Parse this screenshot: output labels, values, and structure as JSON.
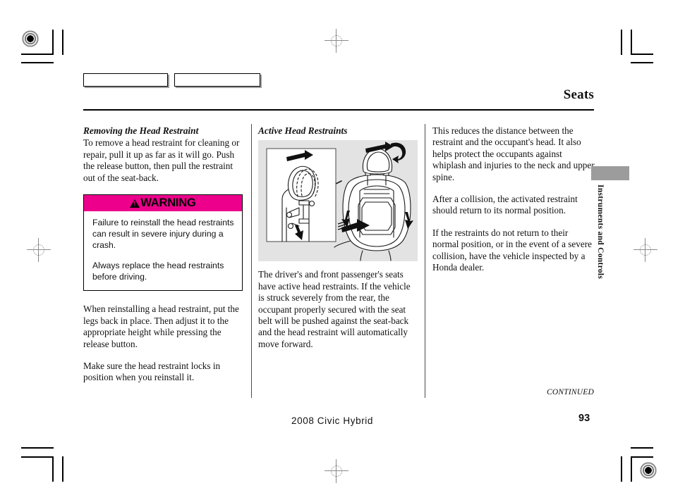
{
  "document": {
    "section_title": "Seats",
    "footer_model": "2008  Civic  Hybrid",
    "page_number": "93",
    "continued_label": "CONTINUED",
    "side_tab_label": "Instruments and Controls"
  },
  "colors": {
    "warning_header_bg": "#ec008c",
    "side_tab_bg": "#9c9c9c",
    "figure_bg": "#e3e3e3",
    "text": "#111111"
  },
  "column1": {
    "heading": "Removing the Head Restraint",
    "paragraphs": [
      "To remove a head restraint for cleaning or repair, pull it up as far as it will go. Push the release button, then pull the restraint out of the seat-back.",
      "When reinstalling a head restraint, put the legs back in place. Then adjust it to the appropriate height while pressing the release button.",
      "Make sure the head restraint locks in position when you reinstall it."
    ],
    "warning": {
      "title": "WARNING",
      "lines": [
        "Failure to reinstall the head restraints can result in severe injury during a crash.",
        "Always replace the head restraints before driving."
      ]
    }
  },
  "column2": {
    "heading": "Active Head Restraints",
    "figure_caption": "",
    "paragraphs": [
      "The driver's and front passenger's seats have active head restraints. If the vehicle is struck severely from the rear, the occupant properly secured with the seat belt will be pushed against the seat-back and the head restraint will automatically move forward."
    ]
  },
  "column3": {
    "paragraphs": [
      "This reduces the distance between the restraint and the occupant's head. It also helps protect the occupants against whiplash and injuries to the neck and upper spine.",
      "After a collision, the activated restraint should return to its normal position.",
      "If the restraints do not return to their normal position, or in the event of a severe collision, have the vehicle inspected by a Honda dealer."
    ]
  }
}
